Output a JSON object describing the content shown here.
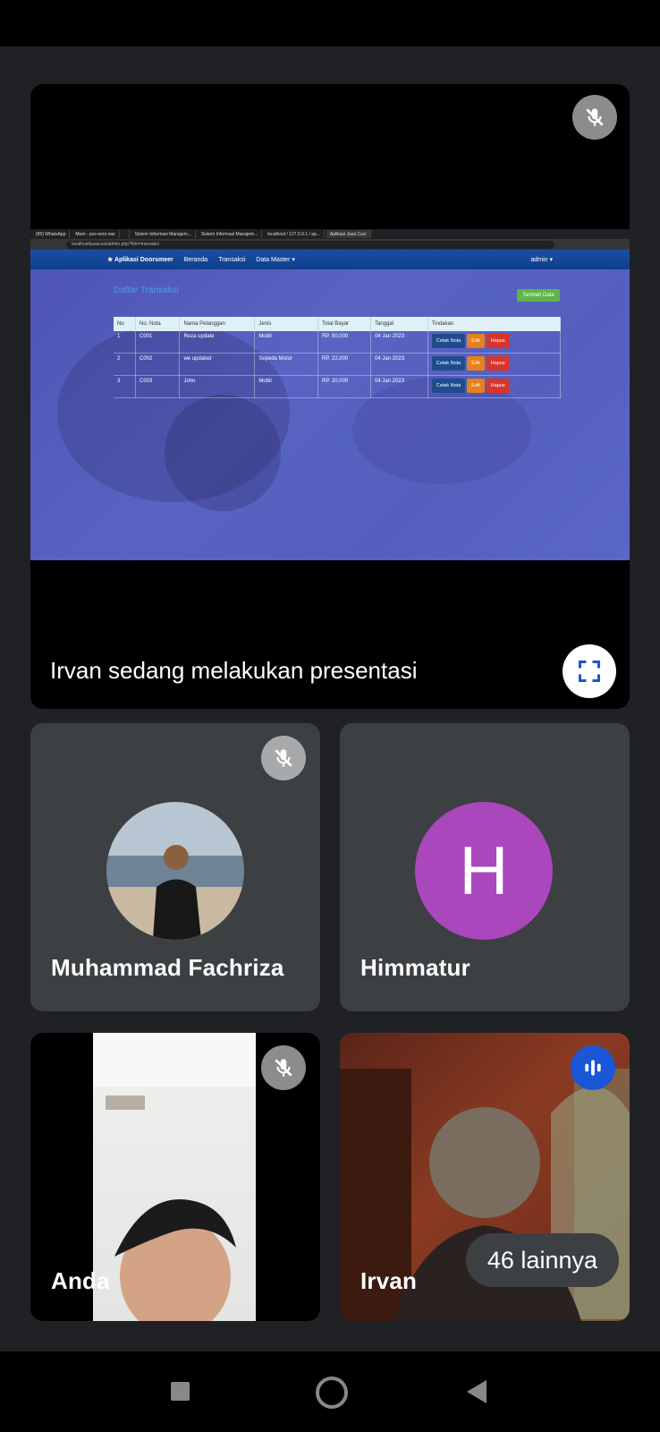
{
  "main_tile": {
    "presenter_label": "Irvan sedang melakukan presentasi",
    "mic_icon": "mic-off-icon",
    "fullscreen_icon": "fullscreen-icon",
    "shared_screen": {
      "tabs": [
        "(85) WhatsApp",
        "Meet - pxs-oerz-vas",
        "",
        "Sistem Informasi Manajem...",
        "Sistem Informasi Manajem...",
        "localhost / 127.0.0.1 / ap...",
        "Aplikasi Jasa Cuci"
      ],
      "url": "localhost/jasacuci/admin.php?hlm=transaksi",
      "app_brand": "★ Aplikasi Doorsmeer",
      "nav": [
        "Beranda",
        "Transaksi",
        "Data Master ▾"
      ],
      "user": "admin ▾",
      "heading": "Daftar Transaksi",
      "add_button": "Tambah Data",
      "table": {
        "headers": [
          "No",
          "No. Nota",
          "Nama Pelanggan",
          "Jenis",
          "Total Bayar",
          "Tanggal",
          "Tindakan"
        ],
        "rows": [
          [
            "1",
            "C001",
            "Reza update",
            "Mobil",
            "RP. 50,000",
            "04 Jan 2023"
          ],
          [
            "2",
            "C002",
            "we updated",
            "Sepeda Motor",
            "RP. 22,000",
            "04 Jan 2023"
          ],
          [
            "3",
            "C003",
            "John",
            "Mobil",
            "RP. 20,000",
            "04 Jan 2023"
          ]
        ],
        "actions": [
          "Cetak Nota",
          "Edit",
          "Hapus"
        ]
      }
    }
  },
  "participants": [
    {
      "name": "Muhammad Fachriza",
      "mic": "mic-off-icon"
    },
    {
      "name": "Himmatur",
      "initial": "H"
    },
    {
      "name": "Anda",
      "mic": "mic-off-icon"
    },
    {
      "name": "Irvan",
      "mic": "audio-level-icon"
    }
  ],
  "more_participants": "46 lainnya",
  "colors": {
    "background": "#202124",
    "tile": "#3c4043",
    "avatar_h": "#ab47bc",
    "speaking_badge": "#1a56d6"
  }
}
